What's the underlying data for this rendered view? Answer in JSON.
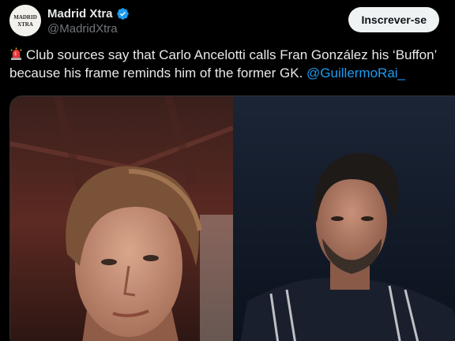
{
  "account": {
    "display_name": "Madrid Xtra",
    "handle": "@MadridXtra",
    "avatar_text_top": "MADRID",
    "avatar_text_bottom": "XTRA",
    "verified_icon": "verified-badge-icon"
  },
  "follow_button": {
    "label": "Inscrever-se"
  },
  "tweet": {
    "emoji_icon": "police-siren-icon",
    "line1": "Club sources say that Carlo Ancelotti calls Fran González his ‘Buffon’",
    "line2": "because his frame reminds him of the former GK.",
    "mention": "@GuillermoRai_"
  },
  "colors": {
    "accent": "#1d9bf0",
    "background": "#000000",
    "text": "#e7e9ea",
    "muted": "#71767b"
  }
}
